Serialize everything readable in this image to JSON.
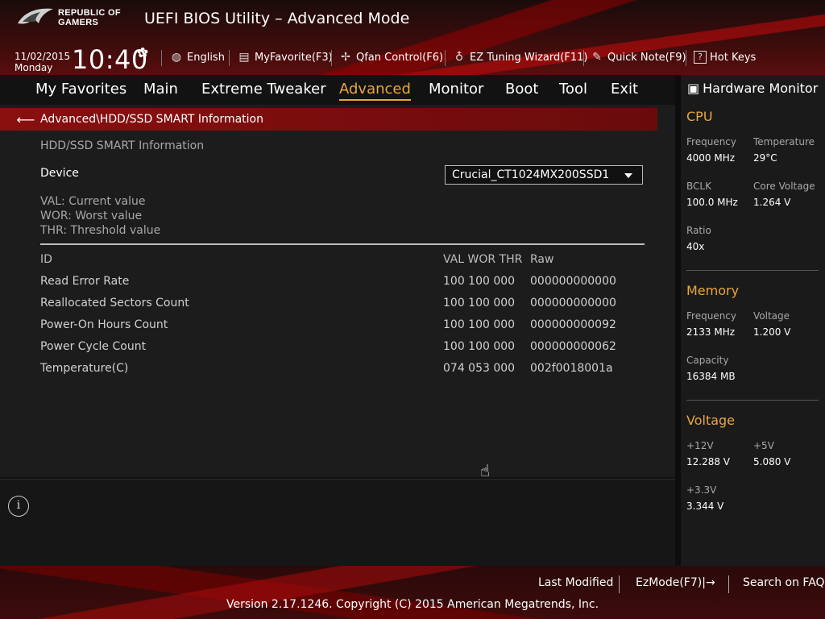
{
  "header": {
    "brand_line1": "REPUBLIC OF",
    "brand_line2": "GAMERS",
    "title": "UEFI BIOS Utility – Advanced Mode",
    "date": "11/02/2015",
    "day": "Monday",
    "time": "10:40",
    "tools": [
      {
        "label": "English",
        "icon": "globe-icon"
      },
      {
        "label": "MyFavorite(F3)",
        "icon": "favorite-icon"
      },
      {
        "label": "Qfan Control(F6)",
        "icon": "fan-icon"
      },
      {
        "label": "EZ Tuning Wizard(F11)",
        "icon": "bulb-icon"
      },
      {
        "label": "Quick Note(F9)",
        "icon": "note-icon"
      },
      {
        "label": "Hot Keys",
        "icon": "help-icon"
      }
    ]
  },
  "menu": {
    "items": [
      "My Favorites",
      "Main",
      "Extreme Tweaker",
      "Advanced",
      "Monitor",
      "Boot",
      "Tool",
      "Exit"
    ],
    "active": "Advanced"
  },
  "content": {
    "breadcrumb": "Advanced\\HDD/SSD SMART Information",
    "section_title": "HDD/SSD SMART Information",
    "device_label": "Device",
    "device_value": "Crucial_CT1024MX200SSD1",
    "legend": [
      "VAL:  Current value",
      "WOR: Worst value",
      "THR:  Threshold value"
    ],
    "columns": {
      "id": "ID",
      "vals": "VAL WOR THR",
      "raw": "Raw"
    },
    "rows": [
      {
        "name": "Read Error Rate",
        "vals": "100  100  000",
        "raw": "000000000000"
      },
      {
        "name": "Reallocated Sectors Count",
        "vals": "100  100  000",
        "raw": "000000000000"
      },
      {
        "name": "Power-On Hours Count",
        "vals": "100  100  000",
        "raw": "000000000092"
      },
      {
        "name": "Power Cycle Count",
        "vals": "100  100  000",
        "raw": "000000000062"
      },
      {
        "name": "Temperature(C)",
        "vals": "074  053  000",
        "raw": "002f0018001a"
      }
    ]
  },
  "hardware_monitor": {
    "title": "Hardware Monitor",
    "cpu": {
      "section": "CPU",
      "frequency_label": "Frequency",
      "frequency": "4000 MHz",
      "temperature_label": "Temperature",
      "temperature": "29°C",
      "bclk_label": "BCLK",
      "bclk": "100.0 MHz",
      "core_voltage_label": "Core Voltage",
      "core_voltage": "1.264 V",
      "ratio_label": "Ratio",
      "ratio": "40x"
    },
    "memory": {
      "section": "Memory",
      "frequency_label": "Frequency",
      "frequency": "2133 MHz",
      "voltage_label": "Voltage",
      "voltage": "1.200 V",
      "capacity_label": "Capacity",
      "capacity": "16384 MB"
    },
    "voltage": {
      "section": "Voltage",
      "v12_label": "+12V",
      "v12": "12.288 V",
      "v5_label": "+5V",
      "v5": "5.080 V",
      "v33_label": "+3.3V",
      "v33": "3.344 V"
    }
  },
  "footer": {
    "last_modified": "Last Modified",
    "ezmode": "EzMode(F7)|→",
    "search_faq": "Search on FAQ",
    "copyright": "Version 2.17.1246. Copyright (C) 2015 American Megatrends, Inc."
  },
  "colors": {
    "accent": "#e9a73b",
    "brand_red": "#8a0f0f"
  }
}
